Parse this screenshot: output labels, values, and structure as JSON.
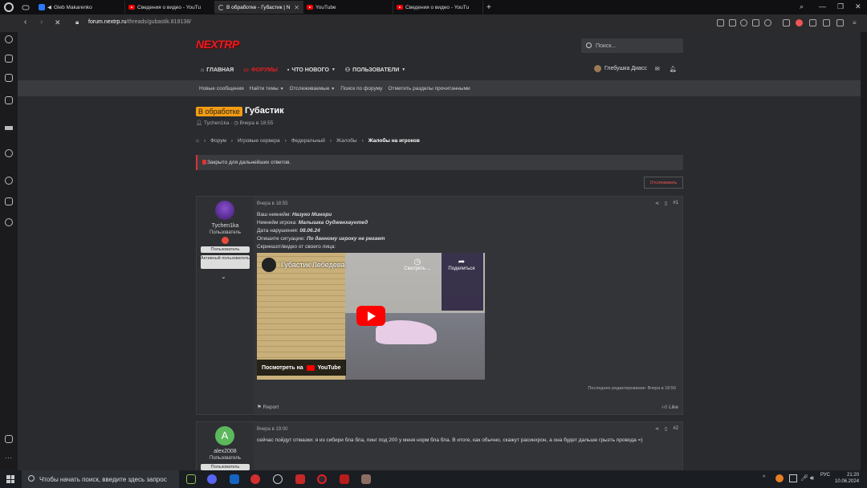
{
  "browser": {
    "tabs": [
      {
        "label": "Gleb Makarenko"
      },
      {
        "label": "Сведения о видео - YouTu"
      },
      {
        "label": "В обработке - Губастик | N"
      },
      {
        "label": "YouTube"
      },
      {
        "label": "Сведения о видео - YouTu"
      }
    ],
    "new_tab": "+",
    "url_domain": "forum.nextrp.ru",
    "url_path": "/threads/gubastik.819138/"
  },
  "site": {
    "logo": "NEXTRP",
    "search_placeholder": "Поиск...",
    "nav": [
      {
        "label": "Главная"
      },
      {
        "label": "Форумы"
      },
      {
        "label": "Что нового"
      },
      {
        "label": "Пользователи"
      }
    ],
    "username": "Глебушка Диасс",
    "subnav": [
      "Новые сообщения",
      "Найти темы",
      "Отслеживаемые",
      "Поиск по форуму",
      "Отметить разделы прочитанными"
    ]
  },
  "thread": {
    "prefix": "В обработке",
    "title": "Губастик",
    "author": "Tychen1ka",
    "date": "Вчера в 18:55",
    "breadcrumbs": [
      "Форум",
      "Игровые сервера",
      "Федеральный",
      "Жалобы",
      "Жалобы на игроков"
    ],
    "closed_notice": "Закрыто для дальнейших ответов.",
    "watch_label": "Отслеживать"
  },
  "posts": [
    {
      "username": "Tychen1ka",
      "role": "Пользователь",
      "badges": [
        "Пользователь",
        "Активный пользователь"
      ],
      "time": "Вчера в 18:55",
      "number": "#1",
      "lines": [
        {
          "label": "Ваш никнейм:",
          "value": "Назуко Минори"
        },
        {
          "label": "Никнейм игрока:",
          "value": "Малышка Оудженхаунтед"
        },
        {
          "label": "Дата нарушения:",
          "value": "08.06.24"
        },
        {
          "label": "Опишите ситуацию:",
          "value": "По данному игроку не регает"
        },
        {
          "label": "Скриншот/видео от своего лица:",
          "value": ""
        }
      ],
      "video": {
        "title": "Губастик Лебедева",
        "watch_later": "Смотреть ...",
        "share": "Поделиться",
        "watch_on": "Посмотреть на",
        "platform": "YouTube"
      },
      "edited": "Последнее редактирование: Вчера в 18:56",
      "report": "Report",
      "like": "Like"
    },
    {
      "username": "alex2008",
      "avatar_letter": "A",
      "role": "Пользователь",
      "badges": [
        "Пользователь"
      ],
      "time": "Вчера в 19:00",
      "number": "#2",
      "text": "сейчас пойдут отмазки: я из сибири бла бла, пинг под 200 у меня норм бла бла. В итоге, как обычно, скажут расинхрон, а она будет дальше грызть провода =)"
    }
  ],
  "taskbar": {
    "search_placeholder": "Чтобы начать поиск, введите здесь запрос",
    "lang": "РУС",
    "time": "21:20",
    "date": "10.06.2024"
  },
  "colors": {
    "accent": "#e31e24",
    "prefix": "#f39c12",
    "bg": "#2a2b2e"
  }
}
